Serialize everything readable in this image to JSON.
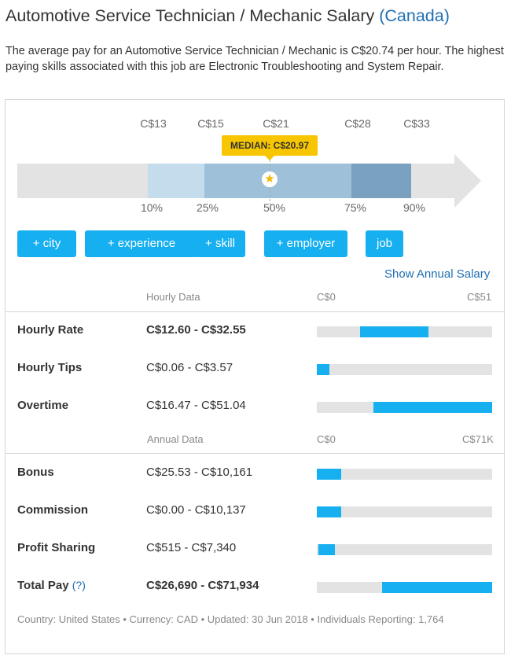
{
  "header": {
    "title": "Automotive Service Technician / Mechanic Salary",
    "country": "(Canada)",
    "intro": "The average pay for an Automotive Service Technician / Mechanic is C$20.74 per hour. The highest paying skills associated with this job are Electronic Troubleshooting and System Repair."
  },
  "distribution": {
    "pay_values": [
      "C$13",
      "C$15",
      "C$21",
      "C$28",
      "C$33"
    ],
    "percentiles": [
      "10%",
      "25%",
      "50%",
      "75%",
      "90%"
    ],
    "median_label": "MEDIAN: C$20.97",
    "colors": {
      "light": "#c5dcec",
      "mid": "#9fc0d9",
      "dark": "#7aa1c0",
      "track": "#e3e3e3",
      "median": "#f7c600"
    }
  },
  "filters": [
    "+ city",
    "+ experience",
    "+ skill",
    "+ employer",
    "job"
  ],
  "show_annual_link": "Show Annual Salary",
  "hourly": {
    "section_label": "Hourly Data",
    "scale_min": "C$0",
    "scale_max": "C$51",
    "max_value": 51,
    "rows": [
      {
        "label": "Hourly Rate",
        "range": "C$12.60 - C$32.55",
        "low": 12.6,
        "high": 32.55,
        "bold": true
      },
      {
        "label": "Hourly Tips",
        "range": "C$0.06 - C$3.57",
        "low": 0.06,
        "high": 3.57,
        "bold": false
      },
      {
        "label": "Overtime",
        "range": "C$16.47 - C$51.04",
        "low": 16.47,
        "high": 51.04,
        "bold": false
      }
    ]
  },
  "annual": {
    "section_label": "Annual Data",
    "scale_min": "C$0",
    "scale_max": "C$71K",
    "max_value": 71934,
    "rows": [
      {
        "label": "Bonus",
        "range": "C$25.53 - C$10,161",
        "low": 25.53,
        "high": 10161,
        "bold": false
      },
      {
        "label": "Commission",
        "range": "C$0.00 - C$10,137",
        "low": 0,
        "high": 10137,
        "bold": false
      },
      {
        "label": "Profit Sharing",
        "range": "C$515 - C$7,340",
        "low": 515,
        "high": 7340,
        "bold": false
      },
      {
        "label": "Total Pay",
        "help": "(?)",
        "range": "C$26,690 - C$71,934",
        "low": 26690,
        "high": 71934,
        "bold": true
      }
    ]
  },
  "footer": "Country: United States • Currency: CAD • Updated: 30 Jun 2018 • Individuals Reporting: 1,764",
  "accent_color": "#16aff0"
}
